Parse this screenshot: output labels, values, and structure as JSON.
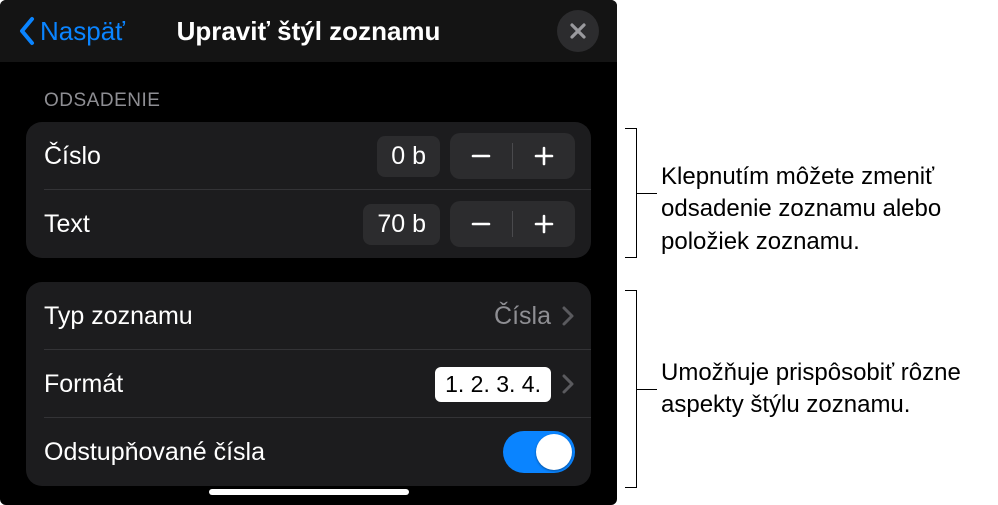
{
  "header": {
    "back_label": "Naspäť",
    "title": "Upraviť štýl zoznamu"
  },
  "section1": {
    "heading": "ODSADENIE",
    "rows": {
      "number": {
        "label": "Číslo",
        "value": "0 b"
      },
      "text": {
        "label": "Text",
        "value": "70 b"
      }
    }
  },
  "section2": {
    "rows": {
      "listType": {
        "label": "Typ zoznamu",
        "value": "Čísla"
      },
      "format": {
        "label": "Formát",
        "value": "1. 2. 3. 4."
      },
      "tiered": {
        "label": "Odstupňované čísla"
      }
    }
  },
  "annotations": {
    "a1": "Klepnutím môžete zmeniť odsadenie zoznamu alebo položiek zoznamu.",
    "a2": "Umožňuje prispôsobiť rôzne aspekty štýlu zoznamu."
  }
}
